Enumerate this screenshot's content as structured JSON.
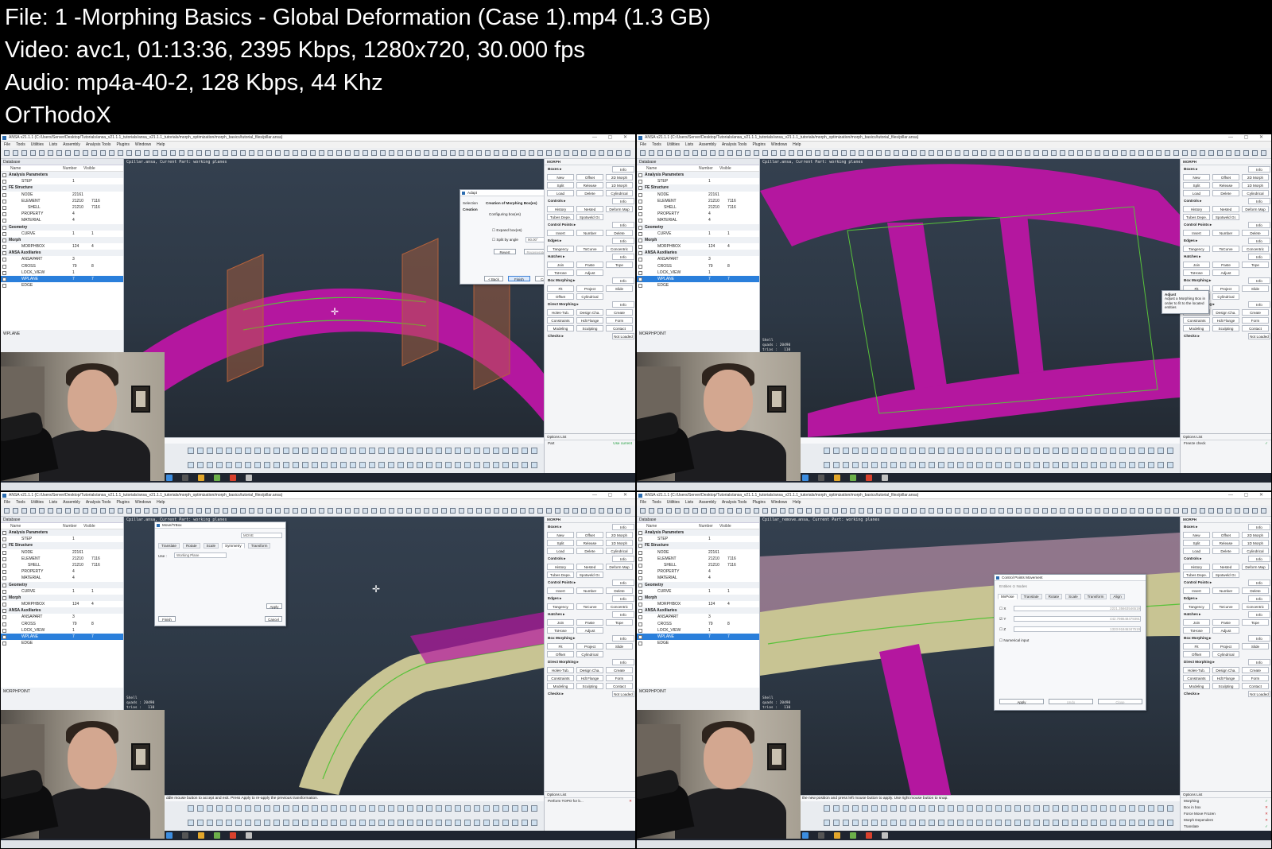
{
  "header": {
    "file": "File: 1 -Morphing Basics - Global Deformation (Case 1).mp4 (1.3 GB)",
    "video": "Video: avc1, 01:13:36, 2395 Kbps, 1280x720, 30.000 fps",
    "audio": "Audio: mp4a-40-2, 128 Kbps, 44 Khz",
    "credit": "OrThodoX"
  },
  "app": {
    "title": "ANSA v21.1.1 (C:/Users/Server/Desktop/Tutorials/ansa_v21.1.1_tutorials/ansa_v21.1.1_tutorials/morph_optimization/morph_basics/tutorial_files/pillar.ansa)",
    "menu": [
      "File",
      "Tools",
      "Utilities",
      "Lists",
      "Assembly",
      "Analysis Tools",
      "Plugins",
      "Windows",
      "Help"
    ],
    "database_label": "Database",
    "columns": {
      "name": "Name",
      "number": "Number",
      "visible": "Visible"
    },
    "viewport_info": "Cpillar.ansa,   Current Part: working planes",
    "viewport_info_b": "Cpillar_remove.ansa,   Current Part: working planes",
    "morph_title": "MORPH",
    "options_list": "Options List"
  },
  "database": [
    {
      "label": "Analysis Parameters",
      "type": "sec"
    },
    {
      "label": "STEP",
      "n": "1",
      "v": "",
      "type": "ind"
    },
    {
      "label": "FE Structure",
      "type": "sec"
    },
    {
      "label": "NODE",
      "n": "22161",
      "v": "",
      "type": "ind"
    },
    {
      "label": "ELEMENT",
      "n": "21210",
      "v": "7116",
      "type": "ind"
    },
    {
      "label": "SHELL",
      "n": "21210",
      "v": "7116",
      "type": "ind2"
    },
    {
      "label": "PROPERTY",
      "n": "4",
      "v": "",
      "type": "ind"
    },
    {
      "label": "MATERIAL",
      "n": "4",
      "v": "",
      "type": "ind"
    },
    {
      "label": "Geometry",
      "type": "sec"
    },
    {
      "label": "CURVE",
      "n": "1",
      "v": "1",
      "type": "ind"
    },
    {
      "label": "Morph",
      "type": "sec"
    },
    {
      "label": "MORPHBOX",
      "n": "124",
      "v": "4",
      "type": "ind"
    },
    {
      "label": "ANSA Auxiliaries",
      "type": "sec"
    },
    {
      "label": "ANSAPART",
      "n": "3",
      "v": "",
      "type": "ind"
    },
    {
      "label": "CROSS",
      "n": "79",
      "v": "8",
      "type": "ind"
    },
    {
      "label": "LOCK_VIEW",
      "n": "1",
      "v": "",
      "type": "ind"
    },
    {
      "label": "WPLANE",
      "n": "7",
      "v": "7",
      "type": "sel"
    },
    {
      "label": "EDGE",
      "n": "",
      "v": "",
      "type": "ind"
    }
  ],
  "db_footers": [
    "WPLANE",
    "MORPHPOINT",
    "MORPHPOINT",
    "MORPHPOINT"
  ],
  "morph_panel": {
    "groups": [
      {
        "label": "Boxes ▸",
        "rows": [
          [
            "New",
            "Offset",
            "2D Morph"
          ],
          [
            "Split",
            "Release",
            "1D Morph"
          ],
          [
            "Load",
            "Delete",
            "Cylindrical"
          ]
        ]
      },
      {
        "label": "Controls ▸",
        "rows": [
          [
            "History",
            "Nested",
            "Deform Map"
          ],
          [
            "Tubes Depe.",
            "Spotweld Gr.",
            ""
          ]
        ]
      },
      {
        "label": "Control Points ▸",
        "rows": [
          [
            "Insert",
            "Number",
            "Delete"
          ]
        ]
      },
      {
        "label": "Edges ▸",
        "rows": [
          [
            "Tangency",
            "ToCurve",
            "Concentric"
          ]
        ]
      },
      {
        "label": "Hatches ▸",
        "rows": [
          [
            "Join",
            "Paste",
            "Tope"
          ],
          [
            "ToHose",
            "Adjust",
            ""
          ]
        ]
      },
      {
        "label": "Box Morphing ▸",
        "rows": [
          [
            "Fit",
            "Project",
            "Slide"
          ],
          [
            "Offset",
            "Cylindrical",
            ""
          ]
        ]
      },
      {
        "label": "Direct Morphing ▸",
        "rows": [
          [
            "Holes-Tub.",
            "Design Cha.",
            "Create"
          ],
          [
            "Constraints",
            "Hdt Flange",
            "Form"
          ],
          [
            "Modeling",
            "Sculpting",
            "Contact"
          ]
        ]
      },
      {
        "label": "Checks ▸",
        "rows": []
      }
    ],
    "info_label": "Info",
    "move_label": "Move",
    "dfm_label": "DFM",
    "not_loaded": "Not Loaded"
  },
  "options": [
    [
      {
        "t": "Part",
        "m": "Use current"
      }
    ],
    [
      {
        "t": "Freeze check",
        "m": "✓"
      }
    ],
    [
      {
        "t": "Perform TOPO for b...",
        "m": "✕"
      }
    ],
    [
      {
        "t": "Morphing",
        "m": "✓"
      },
      {
        "t": "Box in box",
        "m": "✕"
      },
      {
        "t": "Force Move Frozen",
        "m": "✕"
      },
      {
        "t": "Morph Dependent",
        "m": "✕"
      },
      {
        "t": "Translate",
        "m": "✓"
      }
    ]
  ],
  "messages": [
    "",
    "",
    "ddle mouse button to accept and exit. Press Apply to re-apply the previous transformation.",
    "the new position and press left mouse button to apply. Use right mouse button to snap."
  ],
  "viewport_stats": "Shell\nquads : 20490\ntrias :   110\ntotal :  21210",
  "dialog_box": {
    "title": "Adapt",
    "left_items": [
      "Selection",
      "Creation"
    ],
    "heading": "Creation of Morphing Box(es)",
    "group_label": "Configuring box(es)",
    "opt1": "Expand box(es)",
    "opt2": "Split by angle",
    "angle": "90.00°",
    "revert": "Revert",
    "regenerate": "Regenerate",
    "back": "< Back",
    "finish": "Finish",
    "cancel": "Cancel"
  },
  "dialog_transform": {
    "title": "Move/TrBox",
    "mode": "MOVE",
    "tabs": [
      "Translate",
      "Rotate",
      "Scale",
      "Symmetry",
      "Transform"
    ],
    "use_label": "Use :",
    "use_value": "Working Plane",
    "apply": "Apply",
    "finish": "Finish",
    "cancel": "Cancel"
  },
  "dialog_cp": {
    "title": "Control Points Movement",
    "units": "Entities   ⊙ Nodes",
    "tabs": [
      "MvPose",
      "Translate",
      "Rotate",
      "Scale",
      "Transform",
      "Align"
    ],
    "x_label": "X",
    "y_label": "Y",
    "z_label": "Z",
    "x": "2221.35663546519",
    "y": "442.798648479391",
    "z": "1333.91846347519",
    "numeric": "Numerical input",
    "apply": "Apply",
    "undo": "Undo",
    "close": "Close"
  },
  "tooltip": {
    "title": "Adjust",
    "text": "Adjust a Morphing Box in order to fit to the located entities"
  },
  "colors": {
    "magenta": "#b4179f",
    "mesh": "#c8c493",
    "ctrl": "#58c23a",
    "plane": "#b5623b",
    "accent": "#2a7fdb"
  }
}
